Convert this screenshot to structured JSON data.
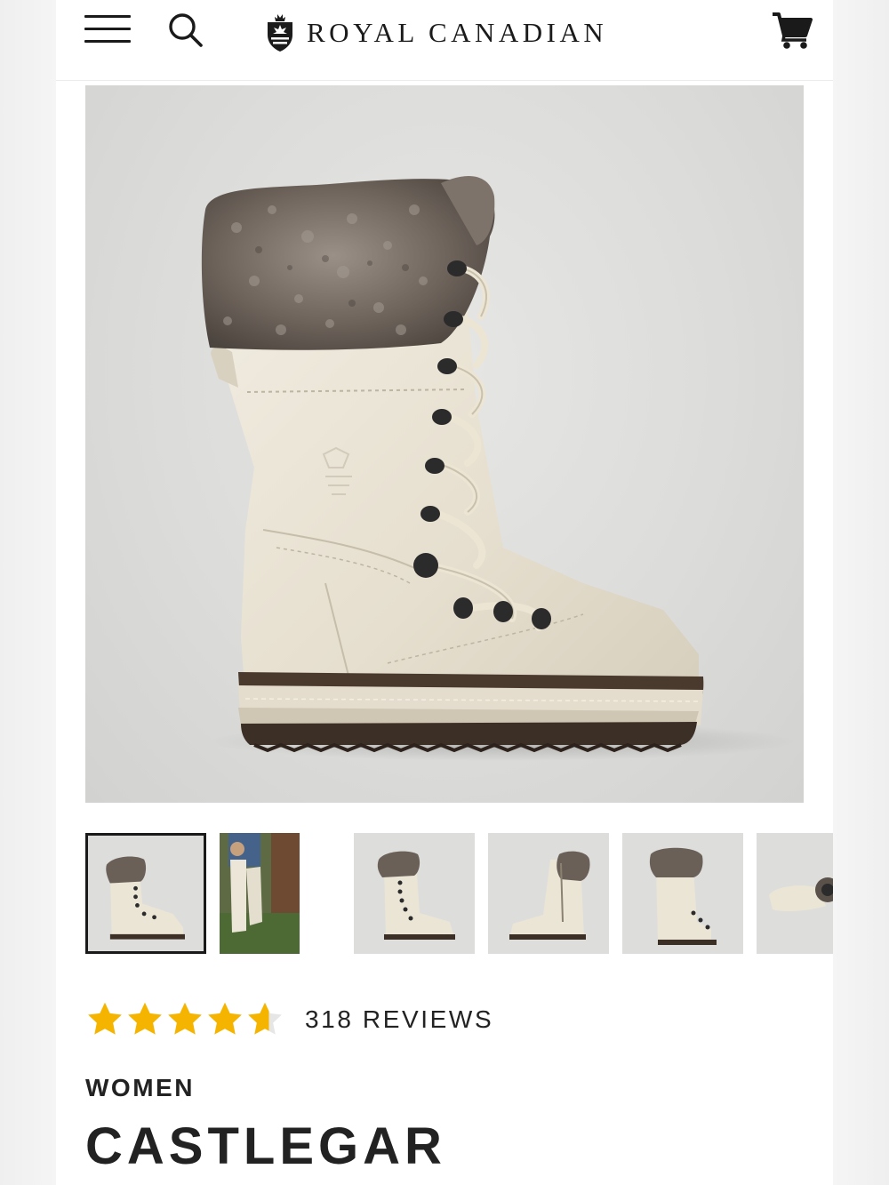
{
  "header": {
    "brand_name": "ROYAL CANADIAN",
    "icons": {
      "menu": "hamburger-menu-icon",
      "search": "search-icon",
      "cart": "cart-icon",
      "crest": "crest-icon"
    }
  },
  "gallery": {
    "main_image": "boot-main-photo",
    "thumbnail_count_visible": 6,
    "selected_index": 0,
    "thumbnails": [
      "boot-side-view",
      "boot-lifestyle-photo",
      "boot-front-angle",
      "boot-inner-side-zip",
      "boot-back-view",
      "boot-sole-view"
    ],
    "printed_logo": "ROYAL CANADIAN"
  },
  "rating": {
    "value": 4.5,
    "max": 5,
    "reviews_label": "318 REVIEWS",
    "star_color": "#f5b400"
  },
  "product": {
    "category": "WOMEN",
    "name": "CASTLEGAR"
  }
}
